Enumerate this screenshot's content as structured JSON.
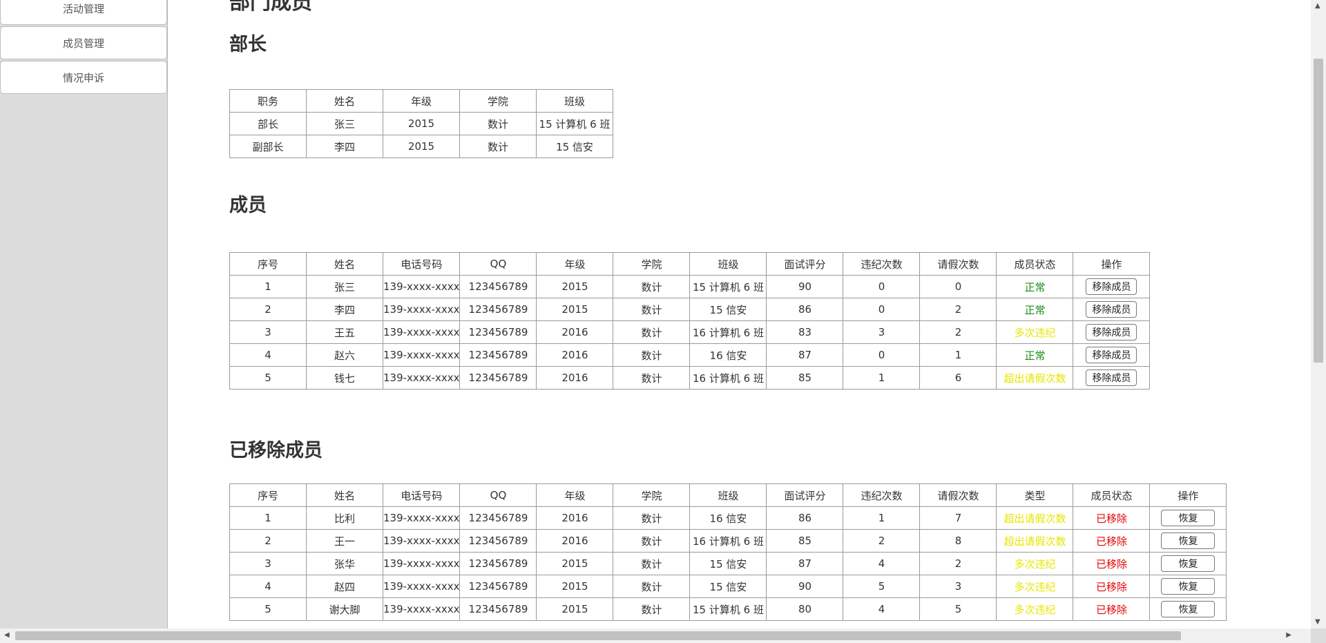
{
  "sidebar": {
    "items": [
      {
        "label": "活动管理"
      },
      {
        "label": "成员管理"
      },
      {
        "label": "情况申诉"
      }
    ]
  },
  "page": {
    "title": "部门成员"
  },
  "leaders": {
    "heading": "部长",
    "headers": [
      "职务",
      "姓名",
      "年级",
      "学院",
      "班级"
    ],
    "rows": [
      [
        "部长",
        "张三",
        "2015",
        "数计",
        "15 计算机 6 班"
      ],
      [
        "副部长",
        "李四",
        "2015",
        "数计",
        "15 信安"
      ]
    ]
  },
  "members": {
    "heading": "成员",
    "headers": [
      "序号",
      "姓名",
      "电话号码",
      "QQ",
      "年级",
      "学院",
      "班级",
      "面试评分",
      "违纪次数",
      "请假次数",
      "成员状态",
      "操作"
    ],
    "action_label": "移除成员",
    "rows": [
      {
        "cells": [
          "1",
          "张三",
          "139-xxxx-xxxx",
          "123456789",
          "2015",
          "数计",
          "15 计算机 6 班",
          "90",
          "0",
          "0"
        ],
        "status": "正常",
        "status_type": "ok"
      },
      {
        "cells": [
          "2",
          "李四",
          "139-xxxx-xxxx",
          "123456789",
          "2015",
          "数计",
          "15 信安",
          "86",
          "0",
          "2"
        ],
        "status": "正常",
        "status_type": "ok"
      },
      {
        "cells": [
          "3",
          "王五",
          "139-xxxx-xxxx",
          "123456789",
          "2016",
          "数计",
          "16 计算机 6 班",
          "83",
          "3",
          "2"
        ],
        "status": "多次违纪",
        "status_type": "warn"
      },
      {
        "cells": [
          "4",
          "赵六",
          "139-xxxx-xxxx",
          "123456789",
          "2016",
          "数计",
          "16 信安",
          "87",
          "0",
          "1"
        ],
        "status": "正常",
        "status_type": "ok"
      },
      {
        "cells": [
          "5",
          "钱七",
          "139-xxxx-xxxx",
          "123456789",
          "2016",
          "数计",
          "16 计算机 6 班",
          "85",
          "1",
          "6"
        ],
        "status": "超出请假次数",
        "status_type": "warn"
      }
    ]
  },
  "removed": {
    "heading": "已移除成员",
    "headers": [
      "序号",
      "姓名",
      "电话号码",
      "QQ",
      "年级",
      "学院",
      "班级",
      "面试评分",
      "违纪次数",
      "请假次数",
      "类型",
      "成员状态",
      "操作"
    ],
    "action_label": "恢复",
    "rows": [
      {
        "cells": [
          "1",
          "比利",
          "139-xxxx-xxxx",
          "123456789",
          "2016",
          "数计",
          "16 信安",
          "86",
          "1",
          "7"
        ],
        "type": "超出请假次数",
        "status": "已移除"
      },
      {
        "cells": [
          "2",
          "王一",
          "139-xxxx-xxxx",
          "123456789",
          "2016",
          "数计",
          "16 计算机 6 班",
          "85",
          "2",
          "8"
        ],
        "type": "超出请假次数",
        "status": "已移除"
      },
      {
        "cells": [
          "3",
          "张华",
          "139-xxxx-xxxx",
          "123456789",
          "2015",
          "数计",
          "15 信安",
          "87",
          "4",
          "2"
        ],
        "type": "多次违纪",
        "status": "已移除"
      },
      {
        "cells": [
          "4",
          "赵四",
          "139-xxxx-xxxx",
          "123456789",
          "2015",
          "数计",
          "15 信安",
          "90",
          "5",
          "3"
        ],
        "type": "多次违纪",
        "status": "已移除"
      },
      {
        "cells": [
          "5",
          "谢大脚",
          "139-xxxx-xxxx",
          "123456789",
          "2015",
          "数计",
          "15 计算机 6 班",
          "80",
          "4",
          "5"
        ],
        "type": "多次违纪",
        "status": "已移除"
      }
    ]
  },
  "colors": {
    "ok": "#1a8c1a",
    "warn": "#e6e600",
    "removed": "#e60000"
  }
}
